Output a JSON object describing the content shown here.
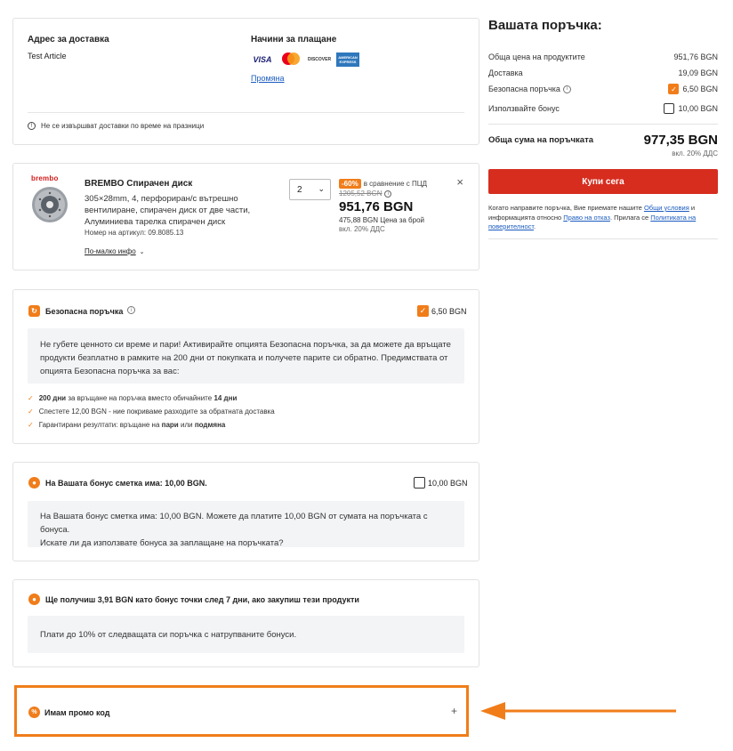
{
  "address": {
    "title": "Адрес за доставка",
    "value": "Test Article",
    "payment_title": "Начини за плащане",
    "payment_logos": [
      "VISA",
      "mastercard",
      "DISCOVER",
      "AMERICAN EXPRESS"
    ],
    "change_link": "Промяна",
    "notice": "Не се извършват доставки по време на празници"
  },
  "product": {
    "brand_logo": "brembo",
    "name": "BREMBO Спирачен диск",
    "desc_line1": "305×28mm, 4, перфориран/с вътрешно",
    "desc_line2": "вентилиране, спирачен диск от две части,",
    "desc_line3": "Алуминиева тарелка спирачен диск",
    "article_no": "Номер на артикул: 09.8085.13",
    "less_info": "По-малко инфо",
    "qty": "2",
    "discount": "-60%",
    "compare_text": "в сравнение с ПЦД",
    "old_price": "1205,52 BGN",
    "price": "951,76 BGN",
    "unit_price": "475,88 BGN Цена за брой",
    "vat": "вкл. 20% ДДС",
    "close_symbol": "×"
  },
  "safe_order": {
    "title": "Безопасна поръчка",
    "price": "6,50 BGN",
    "text_line1": "Не губете ценното си време и пари! Активирайте опцията Безопасна поръчка, за да можете да връщате",
    "text_line2": "продукти безплатно в рамките на 200 дни от покупката и получете парите си обратно. Предимствата от",
    "text_line3": "опцията Безопасна поръчка за вас:",
    "benefit1_a": "200 дни",
    "benefit1_b": "за връщане на поръчка вместо обичайните",
    "benefit1_c": "14 дни",
    "benefit2": "Спестете 12,00 BGN - ние покриваме разходите за обратната доставка",
    "benefit3_a": "Гарантирани резултати: връщане на",
    "benefit3_b": "пари",
    "benefit3_c": "или",
    "benefit3_d": "подмяна"
  },
  "bonus": {
    "title": "На Вашата бонус сметка има: 10,00 BGN.",
    "price": "10,00 BGN",
    "text_line1": "На Вашата бонус сметка има: 10,00 BGN. Можете да платите 10,00 BGN от сумата на поръчката с бонуса.",
    "text_line2": "Искате ли да използвате бонуса за заплащане на поръчката?"
  },
  "points": {
    "title": "Ще получиш 3,91 BGN като бонус точки след 7 дни, ако закупиш тези продукти",
    "text": "Плати до 10% от следващата си поръчка с натрупваните бонуси."
  },
  "promo": {
    "title": "Имам промо код",
    "plus": "+"
  },
  "summary": {
    "title": "Вашата поръчка:",
    "products_label": "Обща цена на продуктите",
    "products_value": "951,76 BGN",
    "delivery_label": "Доставка",
    "delivery_value": "19,09 BGN",
    "safe_label": "Безопасна поръчка",
    "safe_value": "6,50 BGN",
    "bonus_label": "Използвайте бонус",
    "bonus_value": "10,00 BGN",
    "total_label": "Обща сума на поръчката",
    "total_value": "977,35 BGN",
    "total_vat": "вкл. 20% ДДС",
    "buy_button": "Купи сега",
    "terms_1": "Когато направите поръчка, Вие приемате нашите",
    "terms_link1": "Общи условия",
    "terms_2": "и",
    "terms_3": "информацията относно",
    "terms_link2": "Право на отказ",
    "terms_4": ". Прилага се",
    "terms_link3": "Политиката на поверителност",
    "terms_5": "."
  },
  "colors": {
    "accent": "#f07d1a",
    "buy_button": "#d62d1f",
    "link": "#1a5bbf"
  }
}
